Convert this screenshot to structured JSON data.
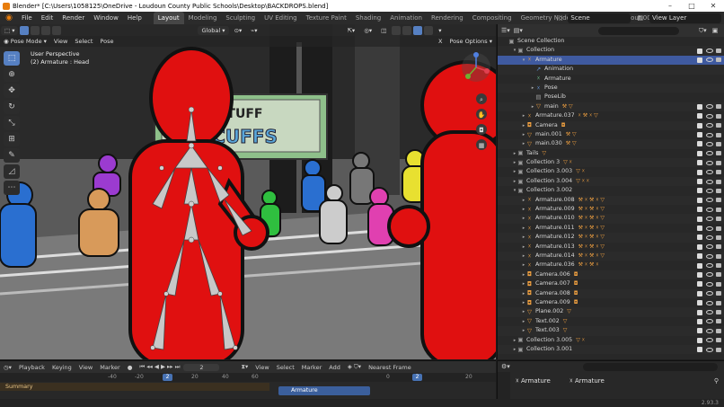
{
  "window": {
    "title": "Blender* [C:\\Users\\1058125\\OneDrive - Loudoun County Public Schools\\Desktop\\BACKDROPS.blend]",
    "buttons": [
      "–",
      "□",
      "✕"
    ]
  },
  "menu": [
    "File",
    "Edit",
    "Render",
    "Window",
    "Help"
  ],
  "workspaces": [
    {
      "label": "Layout",
      "active": true
    },
    {
      "label": "Modeling"
    },
    {
      "label": "Sculpting"
    },
    {
      "label": "UV Editing"
    },
    {
      "label": "Texture Paint"
    },
    {
      "label": "Shading"
    },
    {
      "label": "Animation"
    },
    {
      "label": "Rendering"
    },
    {
      "label": "Compositing"
    },
    {
      "label": "Geometry Nodes"
    },
    {
      "label": "Scripting"
    },
    {
      "label": "Layout.001"
    }
  ],
  "scene": {
    "name": "Scene",
    "view_layer": "View Layer"
  },
  "viewport": {
    "mode": "Pose Mode",
    "menus": [
      "View",
      "Select",
      "Pose"
    ],
    "orientation": "Global",
    "pose_options": "Pose Options",
    "x_axis": "X",
    "info_line1": "User Perspective",
    "info_line2": "(2) Armature : Head",
    "sign_text1": "'N TUFF",
    "sign_text2": "TICUFFS"
  },
  "outliner": {
    "search_placeholder": "",
    "rows": [
      {
        "label": "Scene Collection",
        "indent": 0,
        "icon": "▣",
        "icls": "grey"
      },
      {
        "label": "Collection",
        "indent": 1,
        "exp": "▾",
        "icon": "▣",
        "icls": "grey",
        "vis": true
      },
      {
        "label": "Armature",
        "indent": 2,
        "exp": "▾",
        "icon": "☓",
        "icls": "orange",
        "sel": true,
        "vis": true
      },
      {
        "label": "Animation",
        "indent": 3,
        "icon": "↗",
        "icls": "blue"
      },
      {
        "label": "Armature",
        "indent": 3,
        "icon": "☓",
        "icls": "green"
      },
      {
        "label": "Pose",
        "indent": 3,
        "exp": "▸",
        "icon": "☓",
        "icls": "blue"
      },
      {
        "label": "PoseLib",
        "indent": 3,
        "icon": "▤",
        "icls": "grey"
      },
      {
        "label": "main",
        "indent": 3,
        "exp": "▸",
        "icon": "▽",
        "icls": "orange",
        "mods": "⚒ ▽",
        "vis": true
      },
      {
        "label": "Armature.037",
        "indent": 2,
        "exp": "▸",
        "icon": "☓",
        "icls": "orange",
        "mods": "☓ ⚒ ☓ ▽",
        "vis": true
      },
      {
        "label": "Camera",
        "indent": 2,
        "exp": "▸",
        "icon": "◘",
        "icls": "orange",
        "mods": "◘",
        "vis": true
      },
      {
        "label": "main.001",
        "indent": 2,
        "exp": "▸",
        "icon": "▽",
        "icls": "orange",
        "mods": "⚒ ▽",
        "vis": true
      },
      {
        "label": "main.030",
        "indent": 2,
        "exp": "▸",
        "icon": "▽",
        "icls": "orange",
        "mods": "⚒ ▽",
        "vis": true
      },
      {
        "label": "Tails",
        "indent": 1,
        "exp": "▸",
        "icon": "▣",
        "icls": "grey",
        "mods": "▽",
        "vis": true
      },
      {
        "label": "Collection 3",
        "indent": 1,
        "exp": "▸",
        "icon": "▣",
        "icls": "grey",
        "mods": "▽ ☓",
        "vis": true
      },
      {
        "label": "Collection 3.003",
        "indent": 1,
        "exp": "▸",
        "icon": "▣",
        "icls": "grey",
        "mods": "▽ ☓",
        "vis": true
      },
      {
        "label": "Collection 3.004",
        "indent": 1,
        "exp": "▸",
        "icon": "▣",
        "icls": "grey",
        "mods": "▽ ☓ ☓",
        "vis": true
      },
      {
        "label": "Collection 3.002",
        "indent": 1,
        "exp": "▾",
        "icon": "▣",
        "icls": "grey",
        "vis": true
      },
      {
        "label": "Armature.008",
        "indent": 2,
        "exp": "▸",
        "icon": "☓",
        "icls": "orange",
        "mods": "⚒ ☓ ⚒ ☓ ▽",
        "vis": true
      },
      {
        "label": "Armature.009",
        "indent": 2,
        "exp": "▸",
        "icon": "☓",
        "icls": "orange",
        "mods": "⚒ ☓ ⚒ ☓ ▽",
        "vis": true
      },
      {
        "label": "Armature.010",
        "indent": 2,
        "exp": "▸",
        "icon": "☓",
        "icls": "orange",
        "mods": "⚒ ☓ ⚒ ☓ ▽",
        "vis": true
      },
      {
        "label": "Armature.011",
        "indent": 2,
        "exp": "▸",
        "icon": "☓",
        "icls": "orange",
        "mods": "⚒ ☓ ⚒ ☓ ▽",
        "vis": true
      },
      {
        "label": "Armature.012",
        "indent": 2,
        "exp": "▸",
        "icon": "☓",
        "icls": "orange",
        "mods": "⚒ ☓ ⚒ ☓ ▽",
        "vis": true
      },
      {
        "label": "Armature.013",
        "indent": 2,
        "exp": "▸",
        "icon": "☓",
        "icls": "orange",
        "mods": "⚒ ☓ ⚒ ☓ ▽",
        "vis": true
      },
      {
        "label": "Armature.014",
        "indent": 2,
        "exp": "▸",
        "icon": "☓",
        "icls": "orange",
        "mods": "⚒ ☓ ⚒ ☓ ▽",
        "vis": true
      },
      {
        "label": "Armature.036",
        "indent": 2,
        "exp": "▸",
        "icon": "☓",
        "icls": "orange",
        "mods": "⚒ ☓ ⚒ ☓",
        "vis": true
      },
      {
        "label": "Camera.006",
        "indent": 2,
        "exp": "▸",
        "icon": "◘",
        "icls": "orange",
        "mods": "◘",
        "vis": true
      },
      {
        "label": "Camera.007",
        "indent": 2,
        "exp": "▸",
        "icon": "◘",
        "icls": "orange",
        "mods": "◘",
        "vis": true
      },
      {
        "label": "Camera.008",
        "indent": 2,
        "exp": "▸",
        "icon": "◘",
        "icls": "orange",
        "mods": "◘",
        "vis": true
      },
      {
        "label": "Camera.009",
        "indent": 2,
        "exp": "▸",
        "icon": "◘",
        "icls": "orange",
        "mods": "◘",
        "vis": true
      },
      {
        "label": "Plane.002",
        "indent": 2,
        "exp": "▸",
        "icon": "▽",
        "icls": "orange",
        "mods": "▽",
        "vis": true
      },
      {
        "label": "Text.002",
        "indent": 2,
        "exp": "▸",
        "icon": "▽",
        "icls": "orange",
        "mods": "▽",
        "vis": true
      },
      {
        "label": "Text.003",
        "indent": 2,
        "exp": "▸",
        "icon": "▽",
        "icls": "orange",
        "mods": "▽",
        "vis": true
      },
      {
        "label": "Collection 3.005",
        "indent": 1,
        "exp": "▸",
        "icon": "▣",
        "icls": "grey",
        "mods": "▽ ☓",
        "vis": true
      },
      {
        "label": "Collection 3.001",
        "indent": 1,
        "exp": "▸",
        "icon": "▣",
        "icls": "grey",
        "vis": true
      }
    ]
  },
  "timeline": {
    "menus": [
      "Playback",
      "Keying",
      "View",
      "Marker"
    ],
    "current_frame": "2",
    "ticks": [
      "-40",
      "-20",
      "0",
      "20",
      "40",
      "60"
    ],
    "summary": "Summary",
    "dope_menus": [
      "View",
      "Select",
      "Marker",
      "Add"
    ],
    "dope_ticks": [
      "0",
      "20"
    ],
    "channel": "Armature",
    "nearest_frame": "Nearest Frame"
  },
  "properties": {
    "title": "Armature",
    "data_name": "Armature",
    "row2": "Armature"
  },
  "status": {
    "version": "2.93.3"
  }
}
